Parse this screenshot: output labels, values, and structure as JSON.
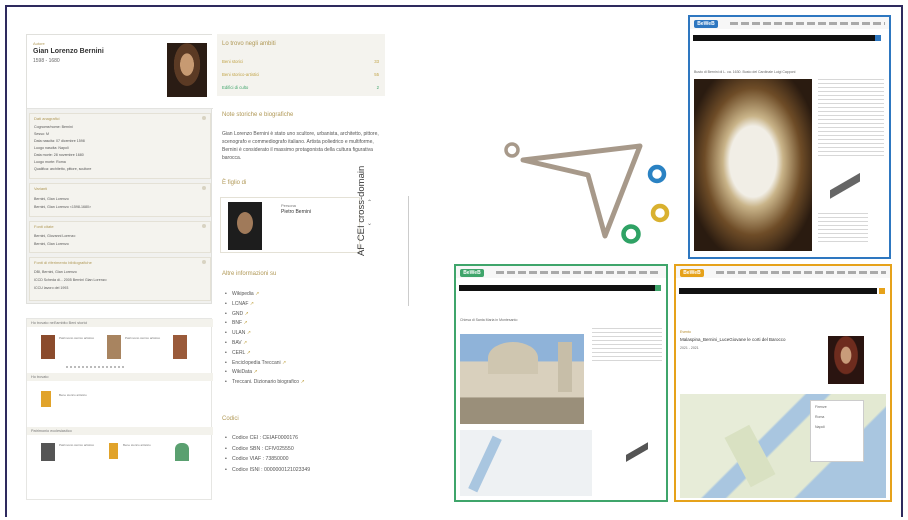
{
  "page_label": "AF CEI cross-domain",
  "authority": {
    "eyebrow": "Autore",
    "name": "Gian Lorenzo Bernini",
    "dates": "1598 - 1680",
    "sections": [
      {
        "title": "Dati anagrafici",
        "lines": [
          "Cognome/nome: Bernini",
          "Sesso: M",
          "Data nascita: 07 dicembre 1598",
          "Luogo nascita: Napoli",
          "Data morte: 28 novembre 1680",
          "Luogo morte: Roma",
          "Qualifica: architetto, pittore, scultore"
        ]
      },
      {
        "title": "Varianti",
        "lines": [
          "Bernini, Gian Lorenzo",
          "Bernini, Gian Lorenzo <1598-1680>"
        ]
      },
      {
        "title": "Fonti citate",
        "lines": [
          "Bernini, Giovanni Lorenzo",
          "Bernini, Gian Lorenzo"
        ]
      },
      {
        "title": "Fonti di riferimento bibliografiche",
        "lines": [
          "DBI, Bernini, Gian Lorenzo",
          "ICCD Scheda di... 2005 Bernini Gian Lorenzo",
          "ICCU lavoro del 1993"
        ]
      }
    ],
    "gallery": {
      "bar1": "Ho trovato nell'ambito  Beni storici",
      "bar2": "Ho trovato",
      "bar3": "Patrimonio ecclesiastico",
      "item_text": "Patrimonio storico artistico",
      "item_sub": "Bene storico artistico"
    }
  },
  "middle": {
    "found_title": "Lo trovo negli ambiti",
    "found_items": [
      {
        "label": "Beni storici",
        "count": "33"
      },
      {
        "label": "Beni storico-artistici",
        "count": "55"
      },
      {
        "label": "Edifici di culto",
        "count": "2"
      }
    ],
    "notes_title": "Note storiche e biografiche",
    "notes_text": "Gian Lorenzo Bernini è stato uno scultore, urbanista, architetto, pittore, scenografo e commediografo italiano. Artista poliedrico e multiforme, Bernini è considerato il massimo protagonista della cultura figurativa barocca.",
    "child_title": "È figlio di",
    "relation_label": "Persona",
    "relation_name": "Pietro Bernini",
    "other_title": "Altre informazioni su",
    "other_links": [
      "Wikipedia",
      "LCNAF",
      "GND",
      "BNF",
      "ULAN",
      "BAV",
      "CERL",
      "Enciclopedia Treccani",
      "WikiData",
      "Treccani. Dizionario biografico"
    ],
    "external_icon": "↗",
    "codes_title": "Codici",
    "codes": [
      "Codice CEI : CEIAF0000176",
      "Codice SBN : CFIV025550",
      "Codice VIAF : 73850000",
      "Codice ISNI : 0000000121023349"
    ]
  },
  "screenshots": {
    "logo": "BeWeB",
    "top_right_caption": "Busto di Bernini di L. ca. 1630. Busto del Cardinale Luigi Capponi",
    "bottom_left_caption": "Chiesa di Santa Maria in Montesanto",
    "bottom_right_caption": "Malaspina_Bernini_LuceGiovane le corti del Barocco",
    "bottom_right_eyebrow": "Evento",
    "bottom_right_dates": "2021 - 2021",
    "map_labels": [
      "Firenze",
      "Roma",
      "Napoli"
    ]
  },
  "colors": {
    "gold": "#c2a447",
    "ring_taupe": "#a7998a",
    "ring_blue": "#2a82c3",
    "ring_gold": "#d9b12f",
    "ring_green": "#2fa265",
    "beweb_blue": "#2e77c0",
    "beweb_green": "#3fa56b",
    "beweb_orange": "#e6a21a",
    "frame": "#2e2a5e"
  }
}
